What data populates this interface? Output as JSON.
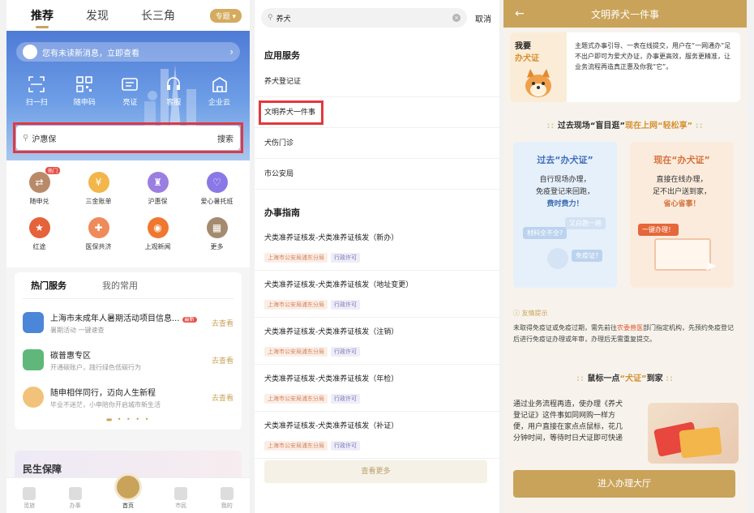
{
  "p1": {
    "tabs": [
      "推荐",
      "发现",
      "长三角"
    ],
    "badge": "专题",
    "notice": "您有未读新消息，立即查看",
    "quick": [
      "扫一扫",
      "随申码",
      "亮证",
      "客服",
      "企业云"
    ],
    "search_placeholder": "沪惠保",
    "search_button": "搜索",
    "grid": [
      "随申兑",
      "三金账单",
      "沪惠保",
      "爱心暑托班",
      "红途",
      "医保共济",
      "上观新闻",
      "更多"
    ],
    "hot_label": "热门",
    "svc_tabs": [
      "热门服务",
      "我的常用"
    ],
    "services": [
      {
        "title": "上海市未成年人暑期活动项目信息...",
        "sub": "暑期活动  一键速查",
        "badge": "最新",
        "go": "去查看"
      },
      {
        "title": "碳普惠专区",
        "sub": "开通碳账户，践行绿色低碳行为",
        "go": "去查看"
      },
      {
        "title": "随申相伴同行，迈向人生新程",
        "sub": "毕业不迷茫，小申陪你开启城市新生活",
        "go": "去查看"
      }
    ],
    "minsheng": "民生保障",
    "nav": [
      "觅旅",
      "办事",
      "首页",
      "市民",
      "我的"
    ]
  },
  "p2": {
    "search_value": "养犬",
    "cancel": "取消",
    "sec1": "应用服务",
    "apps": [
      "养犬登记证",
      "文明养犬一件事",
      "犬伤门诊",
      "市公安局"
    ],
    "sec2": "办事指南",
    "guides": [
      {
        "title": "犬类准养证核发-犬类准养证核发（新办）"
      },
      {
        "title": "犬类准养证核发-犬类准养证核发（地址变更）"
      },
      {
        "title": "犬类准养证核发-犬类准养证核发（注销）"
      },
      {
        "title": "犬类准养证核发-犬类准养证核发（年检）"
      },
      {
        "title": "犬类准养证核发-犬类准养证核发（补证）"
      }
    ],
    "tag1": "上海市公安局浦东分局",
    "tag2": "行政许可",
    "more": "查看更多"
  },
  "p3": {
    "title": "文明养犬一件事",
    "card_a": "我要",
    "card_b": "办犬证",
    "card_text": "主题式办事引导、一表在线提交，用户在“一网通办”足不出户即可为爱犬办证，办事更高效，服务更精准，让业务流程再造真正惠及你我“它”。",
    "h1_pre": "过去现场“盲目逛”",
    "h1_post": "现在上网“轻松享”",
    "past": {
      "title": "过去“办犬证”",
      "l1": "自行现场办理，",
      "l2": "免疫登记来回跑，",
      "emph": "费时费力！",
      "b1": "材料全不全?",
      "b2": "又白跑一趟",
      "b3": "免疫证?"
    },
    "now": {
      "title": "现在“办犬证”",
      "l1": "直接在线办理，",
      "l2": "足不出户送到家，",
      "emph": "省心省事！",
      "btn": "一键办理！"
    },
    "tip_title": "友情提示",
    "tip_a": "未取得免疫证或免疫过期，需先前往",
    "tip_red": "农委兽医",
    "tip_b": "部门指定机构，先预约免疫登记后进行免疫证办理或年审，办理后无需重复提交。",
    "h2_pre": "鼠标一点",
    "h2_mid": "“犬证”",
    "h2_post": "到家",
    "intro": "通过业务流程再造，使办理《养犬登记证》这件事如同网购一样方便，用户直接在家点点鼠标，花几分钟时间，等待时日犬证即可快递",
    "enter": "进入办理大厅"
  }
}
